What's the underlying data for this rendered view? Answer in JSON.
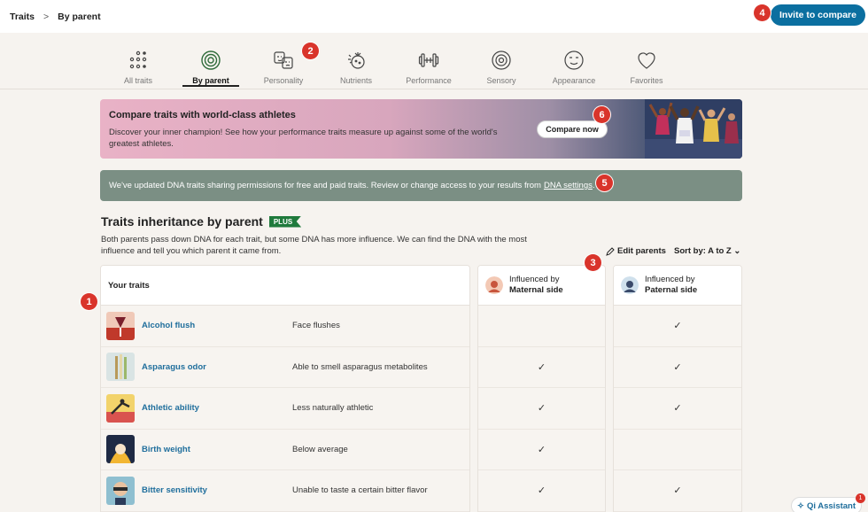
{
  "breadcrumb": {
    "root": "Traits",
    "separator": ">",
    "current": "By parent"
  },
  "header": {
    "invite_label": "Invite to compare"
  },
  "tabs": [
    {
      "label": "All traits",
      "icon": "dots-grid-icon"
    },
    {
      "label": "By parent",
      "icon": "rings-icon"
    },
    {
      "label": "Personality",
      "icon": "masks-icon"
    },
    {
      "label": "Nutrients",
      "icon": "fruit-icon"
    },
    {
      "label": "Performance",
      "icon": "dumbbell-icon"
    },
    {
      "label": "Sensory",
      "icon": "eye-swirl-icon"
    },
    {
      "label": "Appearance",
      "icon": "face-icon"
    },
    {
      "label": "Favorites",
      "icon": "heart-icon"
    }
  ],
  "promo": {
    "title": "Compare traits with world-class athletes",
    "text": "Discover your inner champion! See how your performance traits measure up against some of the world's greatest athletes.",
    "button": "Compare now"
  },
  "notice": {
    "text": "We've updated DNA traits sharing permissions for free and paid traits. Review or change access to your results from",
    "link": "DNA settings",
    "end": "."
  },
  "section": {
    "title": "Traits inheritance by parent",
    "badge": "PLUS",
    "description": "Both parents pass down DNA for each trait, but some DNA has more influence. We can find the DNA with the most influence and tell you which parent it came from.",
    "edit_parents": "Edit parents",
    "sort_by": "Sort by: A to Z"
  },
  "table": {
    "col_traits": "Your traits",
    "col_maternal": {
      "line1": "Influenced by",
      "line2": "Maternal side"
    },
    "col_paternal": {
      "line1": "Influenced by",
      "line2": "Paternal side"
    },
    "rows": [
      {
        "name": "Alcohol flush",
        "result": "Face flushes",
        "maternal": "",
        "paternal": "✓"
      },
      {
        "name": "Asparagus odor",
        "result": "Able to smell asparagus metabolites",
        "maternal": "✓",
        "paternal": "✓"
      },
      {
        "name": "Athletic ability",
        "result": "Less naturally athletic",
        "maternal": "✓",
        "paternal": "✓"
      },
      {
        "name": "Birth weight",
        "result": "Below average",
        "maternal": "✓",
        "paternal": ""
      },
      {
        "name": "Bitter sensitivity",
        "result": "Unable to taste a certain bitter flavor",
        "maternal": "✓",
        "paternal": "✓"
      }
    ]
  },
  "annotations": [
    "1",
    "2",
    "3",
    "4",
    "5",
    "6"
  ],
  "assistant": {
    "label": "Qi Assistant",
    "count": "1"
  },
  "colors": {
    "accent": "#0b6fa0",
    "badge": "#d9342b",
    "plus": "#1f7a3c",
    "notice": "#7b8f84",
    "link": "#1f6e9c"
  }
}
